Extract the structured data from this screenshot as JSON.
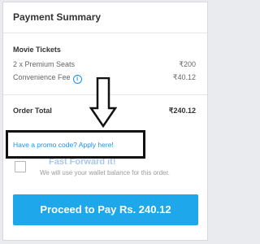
{
  "summary": {
    "title": "Payment Summary",
    "section_label": "Movie Tickets",
    "seats_label": "2 x Premium Seats",
    "seats_value": "₹200",
    "fee_label": "Convenience Fee",
    "fee_info_icon": "i",
    "fee_value": "₹40.12",
    "total_label": "Order Total",
    "total_value": "₹240.12"
  },
  "promo": {
    "link_text": "Have a promo code? Apply here!"
  },
  "wallet": {
    "title": "Fast Forward it!",
    "description": "We will use your wallet balance for this order.",
    "checked": false
  },
  "actions": {
    "pay_label": "Proceed to Pay Rs. 240.12"
  },
  "colors": {
    "accent": "#1fa7ec",
    "link": "#1f8fe8",
    "annotation": "#111111"
  },
  "icons": [
    "info-icon",
    "down-arrow-icon"
  ]
}
